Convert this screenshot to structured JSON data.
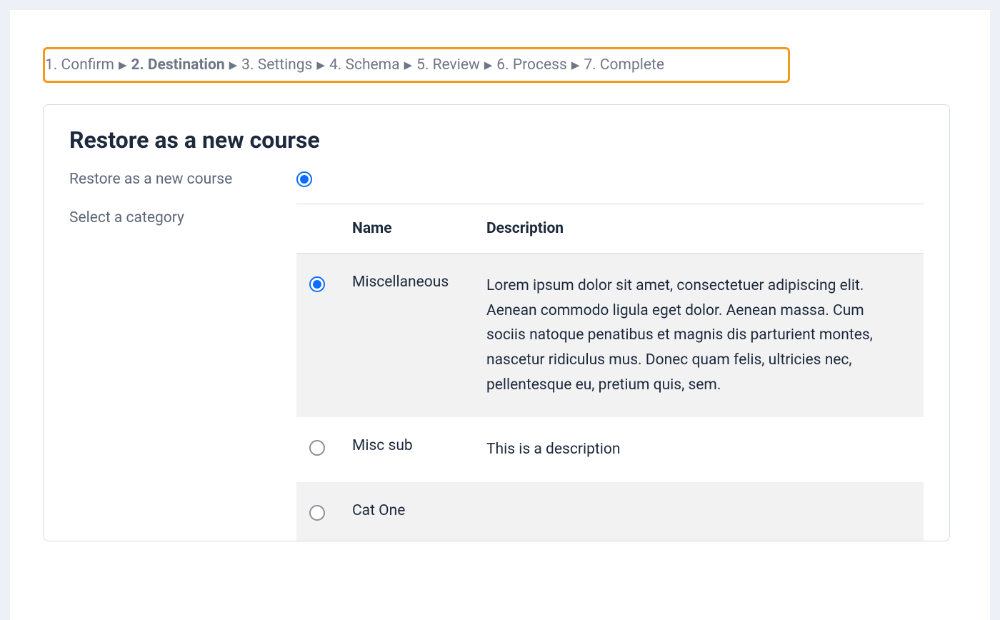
{
  "stepper": {
    "steps": [
      {
        "label": "1. Confirm",
        "active": false
      },
      {
        "label": "2. Destination",
        "active": true
      },
      {
        "label": "3. Settings",
        "active": false
      },
      {
        "label": "4. Schema",
        "active": false
      },
      {
        "label": "5. Review",
        "active": false
      },
      {
        "label": "6. Process",
        "active": false
      },
      {
        "label": "7. Complete",
        "active": false
      }
    ]
  },
  "page": {
    "title": "Restore as a new course",
    "restore_option_label": "Restore as a new course",
    "select_category_label": "Select a category"
  },
  "table": {
    "header_name": "Name",
    "header_description": "Description",
    "categories": [
      {
        "name": "Miscellaneous",
        "description": "Lorem ipsum dolor sit amet, consectetuer adipiscing elit. Aenean commodo ligula eget dolor. Aenean massa. Cum sociis natoque penatibus et magnis dis parturient montes, nascetur ridiculus mus. Donec quam felis, ultricies nec, pellentesque eu, pretium quis, sem.",
        "selected": true
      },
      {
        "name": "Misc sub",
        "description": "This is a description",
        "selected": false
      },
      {
        "name": "Cat One",
        "description": "",
        "selected": false
      }
    ]
  }
}
